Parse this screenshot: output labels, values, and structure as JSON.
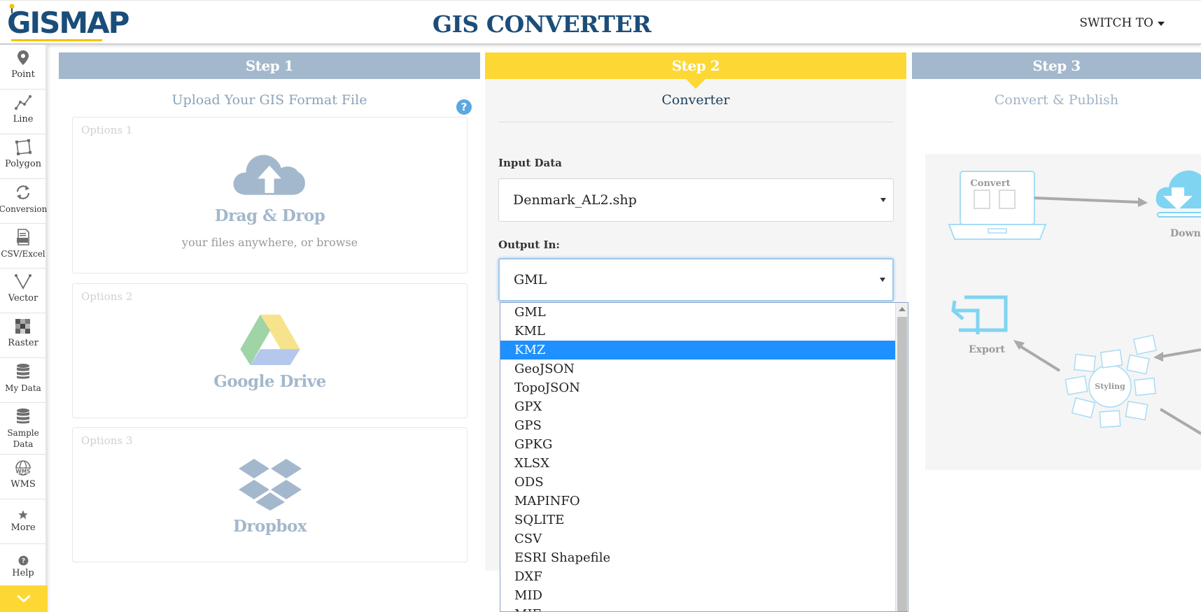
{
  "header": {
    "logo_text": "GISMAP",
    "title": "GIS CONVERTER",
    "switch_label": "SWITCH TO"
  },
  "sidebar": {
    "items": [
      {
        "label": "Point",
        "icon": "map-pin-icon"
      },
      {
        "label": "Line",
        "icon": "line-icon"
      },
      {
        "label": "Polygon",
        "icon": "polygon-icon"
      },
      {
        "label": "Conversion",
        "icon": "refresh-icon"
      },
      {
        "label": "CSV/Excel",
        "icon": "csv-file-icon"
      },
      {
        "label": "Vector",
        "icon": "vector-icon"
      },
      {
        "label": "Raster",
        "icon": "raster-icon"
      },
      {
        "label": "My Data",
        "icon": "database-icon"
      },
      {
        "label": "Sample Data",
        "icon": "database-icon"
      },
      {
        "label": "WMS",
        "icon": "globe-icon"
      },
      {
        "label": "More",
        "icon": "star-icon"
      },
      {
        "label": "Help",
        "icon": "question-icon"
      }
    ]
  },
  "step1": {
    "header": "Step 1",
    "subtitle": "Upload Your GIS Format File",
    "options": [
      {
        "label": "Options 1",
        "title": "Drag & Drop",
        "subtitle": "your files anywhere, or browse"
      },
      {
        "label": "Options 2",
        "title": "Google Drive"
      },
      {
        "label": "Options 3",
        "title": "Dropbox"
      }
    ]
  },
  "step2": {
    "header": "Step 2",
    "subtitle": "Converter",
    "input_label": "Input Data",
    "input_value": "Denmark_AL2.shp",
    "output_label": "Output In:",
    "output_value": "GML",
    "output_options": [
      "GML",
      "KML",
      "KMZ",
      "GeoJSON",
      "TopoJSON",
      "GPX",
      "GPS",
      "GPKG",
      "XLSX",
      "ODS",
      "MAPINFO",
      "SQLITE",
      "CSV",
      "ESRI Shapefile",
      "DXF",
      "MID",
      "MIF"
    ],
    "highlighted_option": "KMZ"
  },
  "step3": {
    "header": "Step 3",
    "subtitle": "Convert & Publish",
    "illustration": {
      "convert": "Convert",
      "download": "Download",
      "export": "Export",
      "styling": "Styling"
    }
  },
  "colors": {
    "step_inactive": "#a3b8cc",
    "step_active": "#fdd835",
    "title_blue": "#1c4d78",
    "highlight": "#1e90ff"
  }
}
